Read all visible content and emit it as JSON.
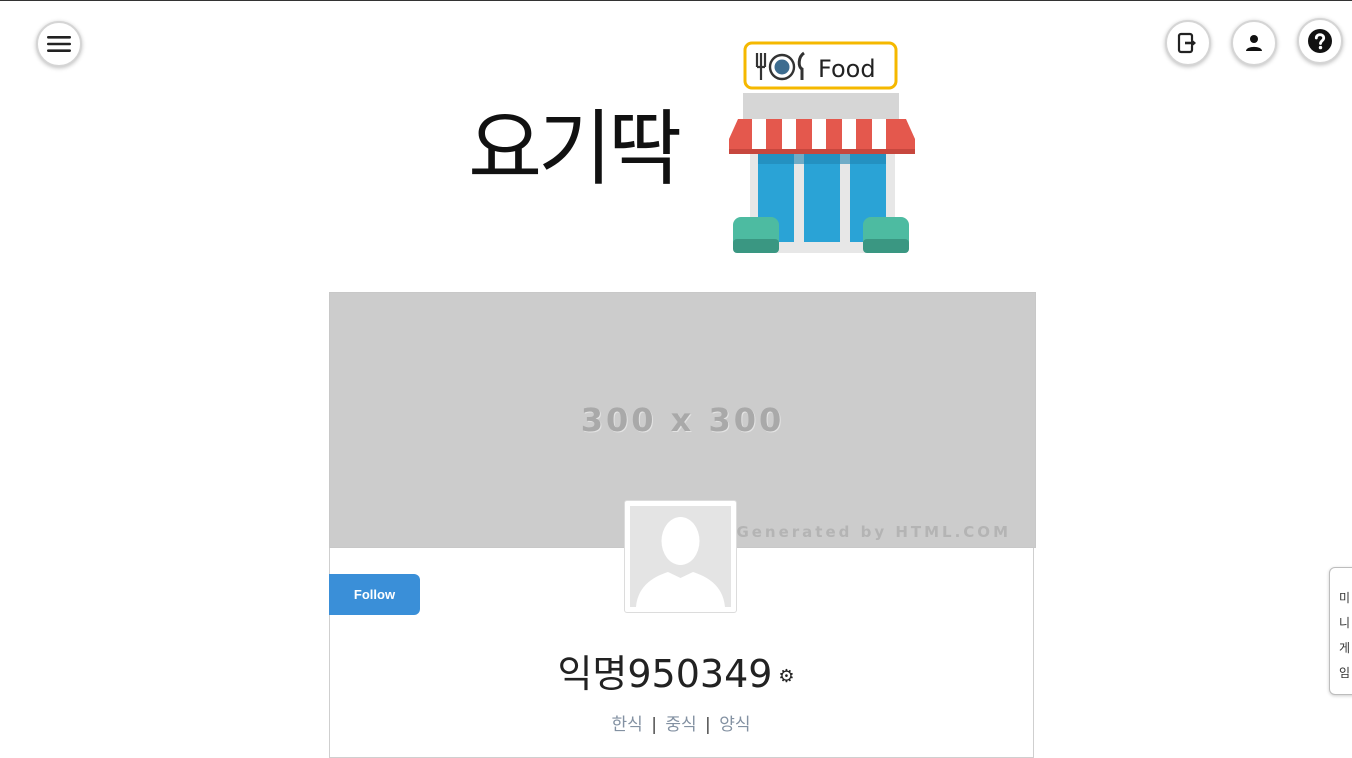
{
  "header": {
    "menu_icon": "hamburger-menu-icon",
    "logout_icon": "logout-icon",
    "user_icon": "user-icon",
    "help_icon": "help-icon"
  },
  "logo": {
    "text": "요기딱",
    "badge_text": "Food"
  },
  "profile": {
    "cover_placeholder": "300 x 300",
    "cover_credit": "Generated by HTML.COM",
    "follow_label": "Follow",
    "username": "익명950349",
    "settings_icon": "gear-icon",
    "categories": [
      "한식",
      "중식",
      "양식"
    ],
    "category_separator": "|"
  },
  "side_tab": {
    "label": "미\n니\n게\n임"
  },
  "colors": {
    "follow_button": "#3a8fd8",
    "category_text": "#8391a2",
    "awning_red": "#e4584d",
    "shop_blue": "#2aa3d6",
    "shop_green": "#4dbba1",
    "badge_border": "#f5b800"
  }
}
